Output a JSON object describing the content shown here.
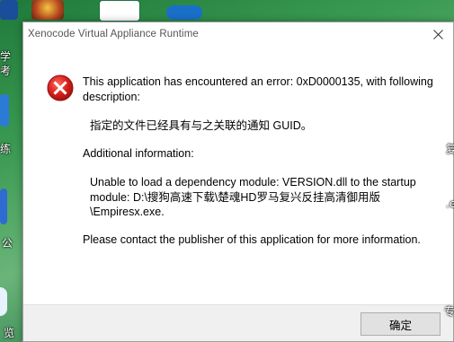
{
  "window": {
    "title": "Xenocode Virtual Appliance Runtime"
  },
  "message": {
    "line1": "This application has encountered an error: 0xD0000135, with following description:",
    "description": "指定的文件已经具有与之关联的通知 GUID。",
    "additional_label": "Additional information:",
    "dependency": "Unable to load a dependency module: VERSION.dll to the startup module: D:\\搜狗高速下载\\楚魂HD罗马复兴反挂高清御用版\\Empiresx.exe.",
    "contact": "Please contact the publisher of this application for more information."
  },
  "buttons": {
    "ok_label": "确定"
  },
  "desktop": {
    "label_top_left": "学\n考",
    "label_mid_left": "练",
    "label_left_gong": "公",
    "label_bottom_left": "览",
    "label_right_1": "复",
    "label_right_2": ".e",
    "label_right_3": "专"
  },
  "colors": {
    "error_red": "#d9201c",
    "dialog_bg": "#ffffff",
    "footer_bg": "#f0f0f0",
    "button_bg": "#e1e1e1"
  },
  "icons": {
    "error": "error-x-icon",
    "close": "close-icon"
  }
}
